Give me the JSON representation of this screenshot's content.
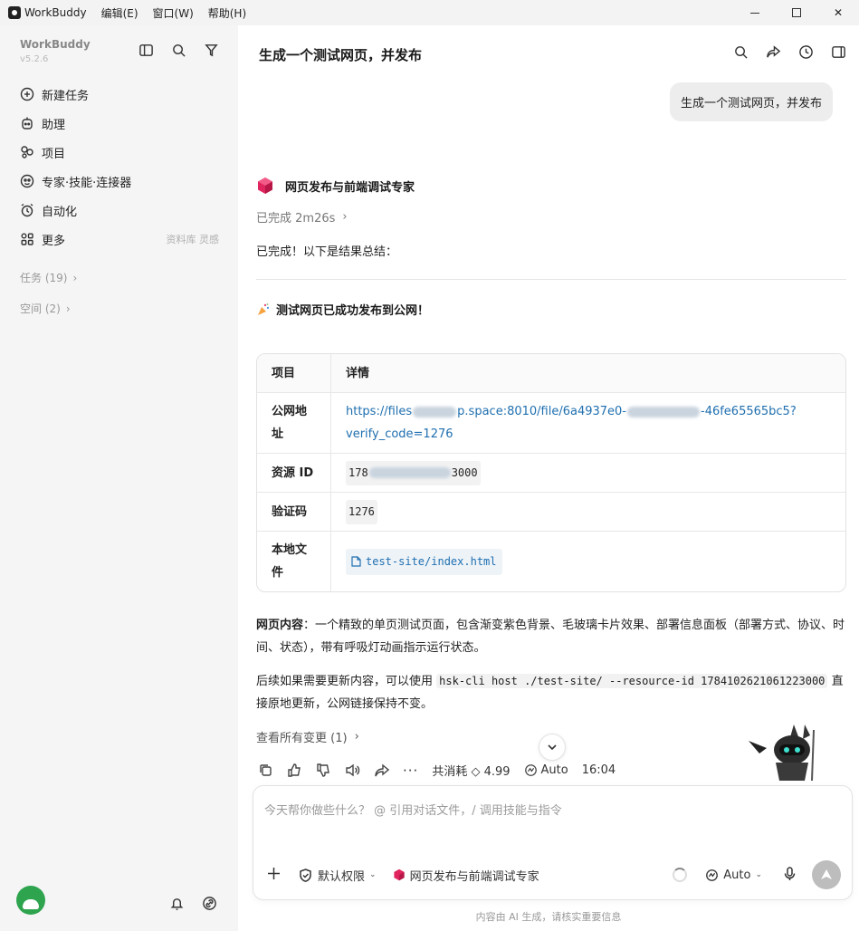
{
  "titlebar": {
    "app_name": "WorkBuddy",
    "menus": [
      "编辑(E)",
      "窗口(W)",
      "帮助(H)"
    ]
  },
  "sidebar": {
    "brand": "WorkBuddy",
    "version": "v5.2.6",
    "nav": [
      {
        "label": "新建任务",
        "icon": "plus-circle-icon"
      },
      {
        "label": "助理",
        "icon": "assistant-icon"
      },
      {
        "label": "项目",
        "icon": "project-icon"
      },
      {
        "label": "专家·技能·连接器",
        "icon": "expert-icon"
      },
      {
        "label": "自动化",
        "icon": "alarm-icon"
      },
      {
        "label": "更多",
        "icon": "grid-icon",
        "extra": "资料库 灵感"
      }
    ],
    "tasks_group": "任务 (19)",
    "spaces_group": "空间 (2)"
  },
  "main": {
    "title": "生成一个测试网页，并发布",
    "user_message": "生成一个测试网页，并发布",
    "agent_name": "网页发布与前端调试专家",
    "agent_color": "#e0245e",
    "status": "已完成 2m26s",
    "summary_intro": "已完成！以下是结果总结：",
    "celebrate": "测试网页已成功发布到公网！",
    "table": {
      "headers": [
        "项目",
        "详情"
      ],
      "rows": [
        {
          "key": "公网地址",
          "url_a": "https://files",
          "url_b": "p.space:8010/file/6a4937e0-",
          "url_c": "-46fe65565bc5?",
          "url_d": "verify_code=1276"
        },
        {
          "key": "资源 ID",
          "id_a": "178",
          "id_b": "3000"
        },
        {
          "key": "验证码",
          "value": "1276"
        },
        {
          "key": "本地文件",
          "file": "test-site/index.html"
        }
      ]
    },
    "content_label": "网页内容",
    "content_text": "：一个精致的单页测试页面，包含渐变紫色背景、毛玻璃卡片效果、部署信息面板（部署方式、协议、时间、状态），带有呼吸灯动画指示运行状态。",
    "followup_a": "后续如果需要更新内容，可以使用",
    "followup_code": "hsk-cli host ./test-site/ --resource-id 1784102621061223000",
    "followup_b": "直接原地更新，公网链接保持不变。",
    "changes_link": "查看所有变更 (1)",
    "usage": "共消耗 ◇ 4.99",
    "model": "Auto",
    "time": "16:04"
  },
  "composer": {
    "placeholder": "今天帮你做些什么？ @ 引用对话文件，/ 调用技能与指令",
    "permission": "默认权限",
    "agent": "网页发布与前端调试专家",
    "model": "Auto"
  },
  "footer_note": "内容由 AI 生成，请核实重要信息"
}
